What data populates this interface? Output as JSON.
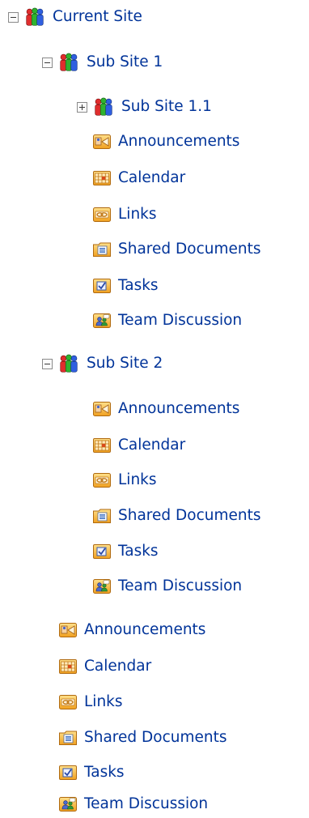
{
  "tree": {
    "root": {
      "label": "Current Site",
      "icon": "site-people-icon",
      "state": "expanded"
    },
    "subsite1": {
      "label": "Sub Site 1",
      "icon": "site-people-icon",
      "state": "expanded"
    },
    "subsite11": {
      "label": "Sub Site 1.1",
      "icon": "site-people-icon",
      "state": "collapsed"
    },
    "subsite2": {
      "label": "Sub Site 2",
      "icon": "site-people-icon",
      "state": "expanded"
    },
    "lists": {
      "announcements": "Announcements",
      "calendar": "Calendar",
      "links": "Links",
      "shared_documents": "Shared Documents",
      "tasks": "Tasks",
      "team_discussion": "Team Discussion"
    }
  },
  "colors": {
    "link_text": "#003399",
    "icon_orange": "#f0a020",
    "icon_yellow": "#ffd36b"
  }
}
